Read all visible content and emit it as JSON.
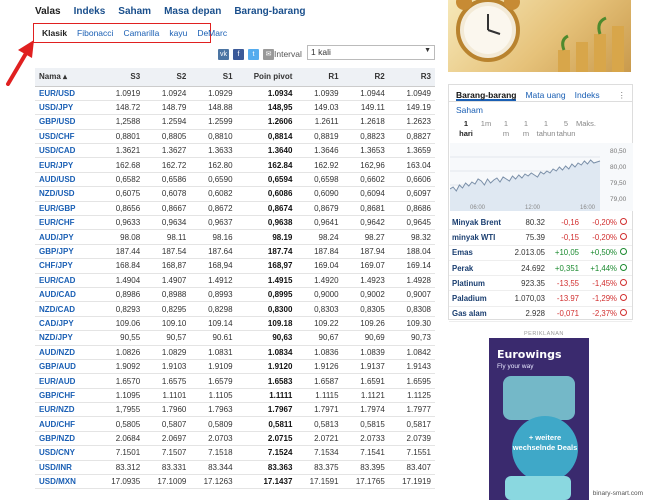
{
  "top_nav": {
    "items": [
      {
        "label": "Valas",
        "active": true
      },
      {
        "label": "Indeks"
      },
      {
        "label": "Saham"
      },
      {
        "label": "Masa depan"
      },
      {
        "label": "Barang-barang"
      }
    ]
  },
  "pivot_tabs": [
    {
      "label": "Klasik",
      "active": true
    },
    {
      "label": "Fibonacci"
    },
    {
      "label": "Camarilla"
    },
    {
      "label": "kayu"
    },
    {
      "label": "DeMarc"
    }
  ],
  "interval": {
    "label": "Interval",
    "value": "1 kali"
  },
  "social": {
    "vk": "vk-icon",
    "facebook": "facebook-icon",
    "twitter": "twitter-icon",
    "email": "email-icon"
  },
  "table": {
    "headers": [
      "Nama",
      "S3",
      "S2",
      "S1",
      "Poin pivot",
      "R1",
      "R2",
      "R3"
    ],
    "rows": [
      [
        "EUR/USD",
        "1.0919",
        "1.0924",
        "1.0929",
        "1.0934",
        "1.0939",
        "1.0944",
        "1.0949"
      ],
      [
        "USD/JPY",
        "148.72",
        "148.79",
        "148.88",
        "148,95",
        "149.03",
        "149.11",
        "149.19"
      ],
      [
        "GBP/USD",
        "1,2588",
        "1.2594",
        "1.2599",
        "1.2606",
        "1.2611",
        "1.2618",
        "1.2623"
      ],
      [
        "USD/CHF",
        "0,8801",
        "0,8805",
        "0,8810",
        "0,8814",
        "0,8819",
        "0,8823",
        "0,8827"
      ],
      [
        "USD/CAD",
        "1.3621",
        "1.3627",
        "1.3633",
        "1.3640",
        "1.3646",
        "1.3653",
        "1.3659"
      ],
      [
        "EUR/JPY",
        "162.68",
        "162.72",
        "162.80",
        "162.84",
        "162.92",
        "162,96",
        "163.04"
      ],
      [
        "AUD/USD",
        "0,6582",
        "0,6586",
        "0,6590",
        "0,6594",
        "0,6598",
        "0,6602",
        "0,6606"
      ],
      [
        "NZD/USD",
        "0,6075",
        "0,6078",
        "0,6082",
        "0,6086",
        "0,6090",
        "0,6094",
        "0,6097"
      ],
      [
        "EUR/GBP",
        "0,8656",
        "0,8667",
        "0,8672",
        "0,8674",
        "0,8679",
        "0,8681",
        "0,8686"
      ],
      [
        "EUR/CHF",
        "0,9633",
        "0,9634",
        "0,9637",
        "0,9638",
        "0,9641",
        "0,9642",
        "0,9645"
      ],
      [
        "AUD/JPY",
        "98.08",
        "98.11",
        "98.16",
        "98.19",
        "98.24",
        "98.27",
        "98.32"
      ],
      [
        "GBP/JPY",
        "187.44",
        "187.54",
        "187.64",
        "187.74",
        "187.84",
        "187.94",
        "188.04"
      ],
      [
        "CHF/JPY",
        "168.84",
        "168,87",
        "168,94",
        "168,97",
        "169.04",
        "169.07",
        "169.14"
      ],
      [
        "EUR/CAD",
        "1.4904",
        "1.4907",
        "1.4912",
        "1.4915",
        "1.4920",
        "1.4923",
        "1.4928"
      ],
      [
        "AUD/CAD",
        "0,8986",
        "0,8988",
        "0,8993",
        "0,8995",
        "0,9000",
        "0,9002",
        "0,9007"
      ],
      [
        "NZD/CAD",
        "0,8293",
        "0,8295",
        "0,8298",
        "0,8300",
        "0,8303",
        "0,8305",
        "0,8308"
      ],
      [
        "CAD/JPY",
        "109.06",
        "109.10",
        "109.14",
        "109.18",
        "109.22",
        "109.26",
        "109.30"
      ],
      [
        "NZD/JPY",
        "90,55",
        "90,57",
        "90.61",
        "90,63",
        "90,67",
        "90,69",
        "90,73"
      ],
      [
        "AUD/NZD",
        "1.0826",
        "1.0829",
        "1.0831",
        "1.0834",
        "1.0836",
        "1.0839",
        "1.0842"
      ],
      [
        "GBP/AUD",
        "1.9092",
        "1.9103",
        "1.9109",
        "1.9120",
        "1.9126",
        "1.9137",
        "1.9143"
      ],
      [
        "EUR/AUD",
        "1.6570",
        "1.6575",
        "1.6579",
        "1.6583",
        "1.6587",
        "1.6591",
        "1.6595"
      ],
      [
        "GBP/CHF",
        "1.1095",
        "1.1101",
        "1.1105",
        "1.1111",
        "1.1115",
        "1.1121",
        "1.1125"
      ],
      [
        "EUR/NZD",
        "1,7955",
        "1.7960",
        "1.7963",
        "1.7967",
        "1.7971",
        "1.7974",
        "1.7977"
      ],
      [
        "AUD/CHF",
        "0,5805",
        "0,5807",
        "0,5809",
        "0,5811",
        "0,5813",
        "0,5815",
        "0,5817"
      ],
      [
        "GBP/NZD",
        "2.0684",
        "2.0697",
        "2.0703",
        "2.0715",
        "2.0721",
        "2.0733",
        "2.0739"
      ],
      [
        "USD/CNY",
        "7.1501",
        "7.1507",
        "7.1518",
        "7.1524",
        "7.1534",
        "7.1541",
        "7.1551"
      ],
      [
        "USD/INR",
        "83.312",
        "83.331",
        "83.344",
        "83.363",
        "83.375",
        "83.395",
        "83.407"
      ],
      [
        "USD/MXN",
        "17.0935",
        "17.1009",
        "17.1263",
        "17.1437",
        "17.1591",
        "17.1765",
        "17.1919"
      ]
    ]
  },
  "sidebar": {
    "tabs": [
      {
        "label": "Barang-barang",
        "active": true
      },
      {
        "label": "Mata uang"
      },
      {
        "label": "Indeks"
      }
    ],
    "more_icon": "more-vertical-icon",
    "section_title": "Saham",
    "periods": [
      {
        "label": "1",
        "sub": "hari",
        "active": true
      },
      {
        "label": "1m"
      },
      {
        "label": "1",
        "sub": "m"
      },
      {
        "label": "1",
        "sub": "m"
      },
      {
        "label": "1",
        "sub": "tahun"
      },
      {
        "label": "5",
        "sub": "tahun"
      },
      {
        "label": "Maks."
      }
    ],
    "chart_axis": [
      "80,50",
      "80,00",
      "79,50",
      "79,00"
    ],
    "chart_times": [
      "06:00",
      "12:00",
      "16:00"
    ],
    "prices": [
      {
        "name": "Minyak Brent",
        "value": "80.32",
        "change": "-0,16",
        "pct": "-0,20%",
        "dir": "neg"
      },
      {
        "name": "minyak WTI",
        "value": "75.39",
        "change": "-0,15",
        "pct": "-0,20%",
        "dir": "neg"
      },
      {
        "name": "Emas",
        "value": "2.013.05",
        "change": "+10,05",
        "pct": "+0,50%",
        "dir": "pos"
      },
      {
        "name": "Perak",
        "value": "24.692",
        "change": "+0,351",
        "pct": "+1,44%",
        "dir": "pos"
      },
      {
        "name": "Platinum",
        "value": "923.35",
        "change": "-13,55",
        "pct": "-1,45%",
        "dir": "neg"
      },
      {
        "name": "Paladium",
        "value": "1.070,03",
        "change": "-13.97",
        "pct": "-1,29%",
        "dir": "neg"
      },
      {
        "name": "Gas alam",
        "value": "2.928",
        "change": "-0,071",
        "pct": "-2,37%",
        "dir": "neg"
      }
    ]
  },
  "ad": {
    "label": "PERIKLANAN",
    "brand": "Eurowings",
    "tagline": "Fly your way",
    "circle_text": "+ weitere wechselnde Deals"
  },
  "watermark": "binary-smart.com"
}
